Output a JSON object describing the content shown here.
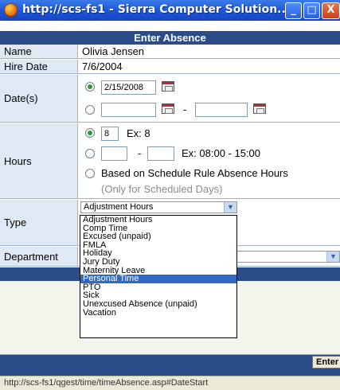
{
  "window": {
    "title": "http://scs-fs1 - Sierra Computer Solution...",
    "minimize": "_",
    "maximize": "□",
    "close": "X"
  },
  "form": {
    "header": "Enter Absence",
    "name_label": "Name",
    "name_value": "Olivia Jensen",
    "hire_label": "Hire Date",
    "hire_value": "7/6/2004",
    "dates_label": "Date(s)",
    "date_single": "2/15/2008",
    "date_range_from": "",
    "date_range_sep": "-",
    "date_range_to": "",
    "hours_label": "Hours",
    "hours_value": "8",
    "hours_example": "Ex: 8",
    "hours_range_start": "",
    "hours_range_sep": "-",
    "hours_range_end": "",
    "hours_range_example": "Ex: 08:00 - 15:00",
    "schedule_rule": "Based on Schedule Rule Absence Hours",
    "schedule_note": "(Only for Scheduled Days)",
    "type_label": "Type",
    "type_selected": "Adjustment Hours",
    "department_label": "Department",
    "enter_button": "Enter"
  },
  "type_options": [
    "Adjustment Hours",
    "Comp Time",
    "Excused (unpaid)",
    "FMLA",
    "Holiday",
    "Jury Duty",
    "Maternity Leave",
    "Personal Time",
    "PTO",
    "Sick",
    "Unexcused Absence (unpaid)",
    "Vacation"
  ],
  "highlighted_option": "Personal Time",
  "status": {
    "url": "http://scs-fs1/qgest/time/timeAbsence.asp#DateStart"
  },
  "colors": {
    "header_bg": "#2b4e8a",
    "label_bg": "#dfe8f5",
    "selection": "#316ac5",
    "radio_on": "#2f9a2f"
  }
}
